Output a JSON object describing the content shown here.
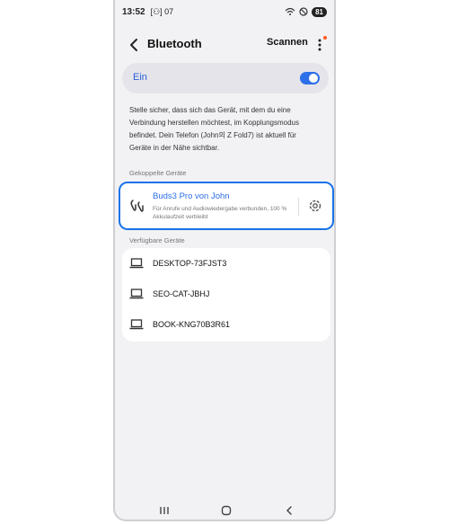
{
  "status_bar": {
    "time": "13:52",
    "notification": "[⚇] 07",
    "battery": "81"
  },
  "header": {
    "title": "Bluetooth",
    "scan_label": "Scannen"
  },
  "toggle": {
    "label": "Ein",
    "state": "on"
  },
  "description": "Stelle sicher, dass sich das Gerät, mit dem du eine Verbindung herstellen möchtest, im Kopplungsmodus befindet. Dein Telefon (John의 Z Fold7) ist aktuell für Geräte in der Nähe sichtbar.",
  "paired": {
    "section_label": "Gekoppelte Geräte",
    "device": {
      "name": "Buds3 Pro von John",
      "status": "Für Anrufe und Audiowiedergabe verbunden, 100 % Akkulaufzeit verbleibt"
    }
  },
  "available": {
    "section_label": "Verfügbare Geräte",
    "devices": [
      {
        "name": "DESKTOP-73FJST3"
      },
      {
        "name": "SEO-CAT-JBHJ"
      },
      {
        "name": "BOOK-KNG70B3R61"
      }
    ]
  },
  "colors": {
    "accent": "#2c6fe8",
    "highlight_border": "#1a73e8",
    "background": "#f2f2f5"
  },
  "icons": [
    "back-arrow-icon",
    "more-options-icon",
    "earbuds-icon",
    "gear-icon",
    "laptop-icon",
    "nav-recent-icon",
    "nav-home-icon",
    "nav-back-icon"
  ]
}
